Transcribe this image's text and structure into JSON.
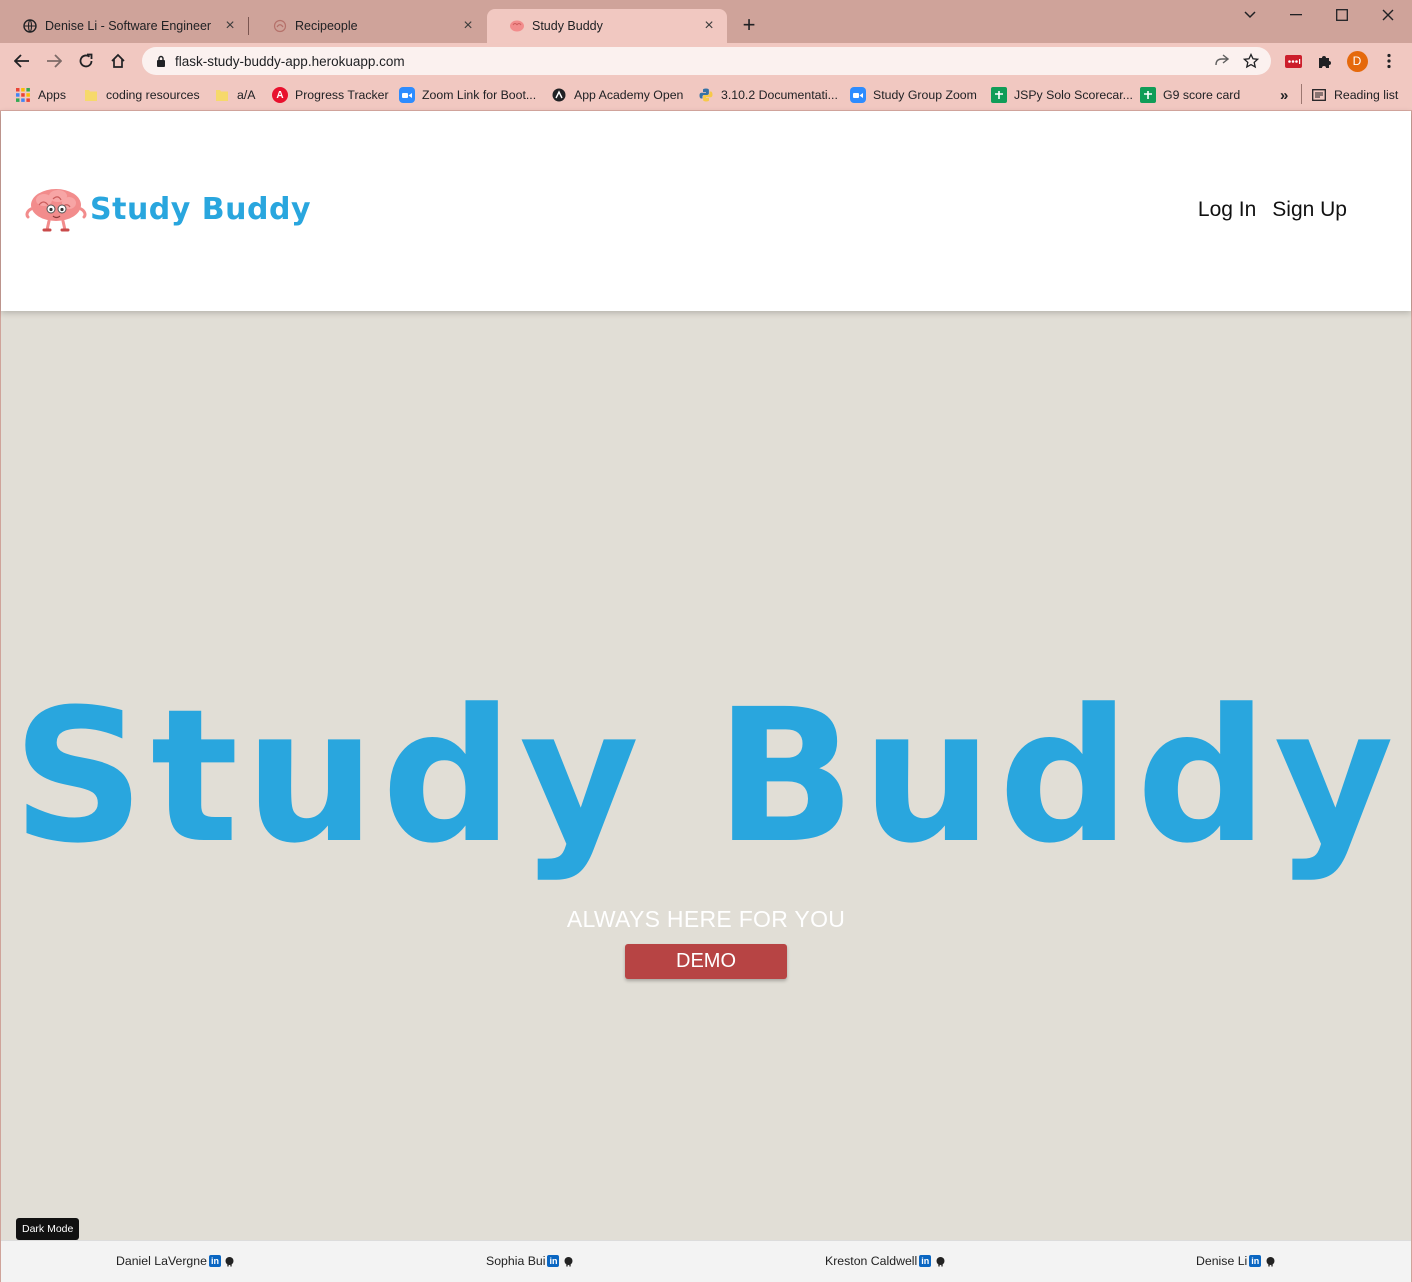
{
  "browser": {
    "tabs": [
      {
        "title": "Denise Li - Software Engineer",
        "icon": "globe-icon"
      },
      {
        "title": "Recipeople",
        "icon": "recipeople-favicon"
      },
      {
        "title": "Study Buddy",
        "icon": "brain-favicon",
        "active": true
      }
    ],
    "new_tab": "+",
    "url": "flask-study-buddy-app.herokuapp.com",
    "profile_initial": "D",
    "bookmarks": [
      {
        "label": "Apps",
        "icon": "apps-grid-icon"
      },
      {
        "label": "coding resources",
        "icon": "folder-icon"
      },
      {
        "label": "a/A",
        "icon": "folder-icon"
      },
      {
        "label": "Progress Tracker",
        "icon": "progress-tracker-icon"
      },
      {
        "label": "Zoom Link for Boot...",
        "icon": "zoom-icon"
      },
      {
        "label": "App Academy Open",
        "icon": "app-academy-icon"
      },
      {
        "label": "3.10.2 Documentati...",
        "icon": "python-icon"
      },
      {
        "label": "Study Group Zoom",
        "icon": "zoom-icon"
      },
      {
        "label": "JSPy Solo Scorecar...",
        "icon": "sheets-icon"
      },
      {
        "label": "G9 score card",
        "icon": "sheets-icon"
      }
    ],
    "more_bookmarks": "»",
    "reading_list": "Reading list"
  },
  "site": {
    "logo_text": "Study Buddy",
    "nav": {
      "login": "Log In",
      "signup": "Sign Up"
    },
    "hero_title": "Study Buddy",
    "tagline": "ALWAYS HERE FOR YOU",
    "demo_label": "DEMO",
    "dark_mode_label": "Dark Mode",
    "developers": [
      "Daniel LaVergne",
      "Sophia Bui",
      "Kreston Caldwell",
      "Denise Li"
    ]
  },
  "colors": {
    "brand_blue": "#29a6de",
    "demo_red": "#b74444",
    "page_bg": "#e1ded6",
    "browser_frame": "#cfa39a"
  }
}
